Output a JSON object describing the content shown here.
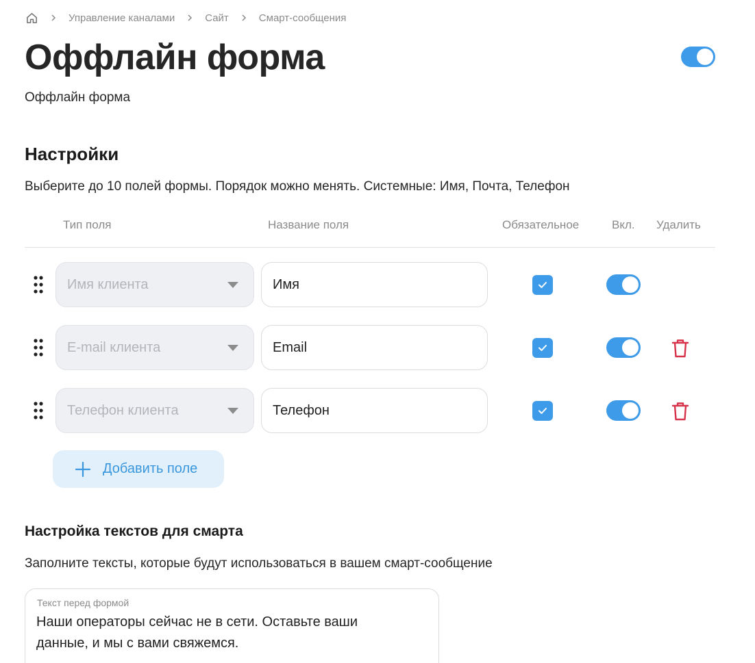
{
  "breadcrumb": {
    "home_icon": "home-icon",
    "items": [
      "Управление каналами",
      "Сайт",
      "Смарт-сообщения"
    ]
  },
  "page": {
    "title": "Оффлайн форма",
    "description": "Оффлайн форма",
    "enabled": true
  },
  "settings": {
    "title": "Настройки",
    "description": "Выберите до 10 полей формы. Порядок можно менять. Системные: Имя, Почта, Телефон",
    "columns": {
      "field_type": "Тип поля",
      "field_name": "Название поля",
      "required": "Обязательное",
      "enabled": "Вкл.",
      "delete": "Удалить"
    },
    "rows": [
      {
        "type": "Имя клиента",
        "name": "Имя",
        "required": true,
        "enabled": true,
        "deletable": false
      },
      {
        "type": "E-mail клиента",
        "name": "Email",
        "required": true,
        "enabled": true,
        "deletable": true
      },
      {
        "type": "Телефон клиента",
        "name": "Телефон",
        "required": true,
        "enabled": true,
        "deletable": true
      }
    ],
    "add_button_label": "Добавить поле"
  },
  "texts": {
    "title": "Настройка текстов для смарта",
    "description": "Заполните тексты, которые будут использоваться в вашем смарт-сообщение",
    "before_form": {
      "label": "Текст перед формой",
      "value": "Наши операторы сейчас не в сети. Оставьте ваши данные, и мы с вами свяжемся."
    }
  },
  "colors": {
    "accent": "#3d9be9",
    "delete": "#d8324b",
    "add_button_bg": "#e1f0fb"
  }
}
